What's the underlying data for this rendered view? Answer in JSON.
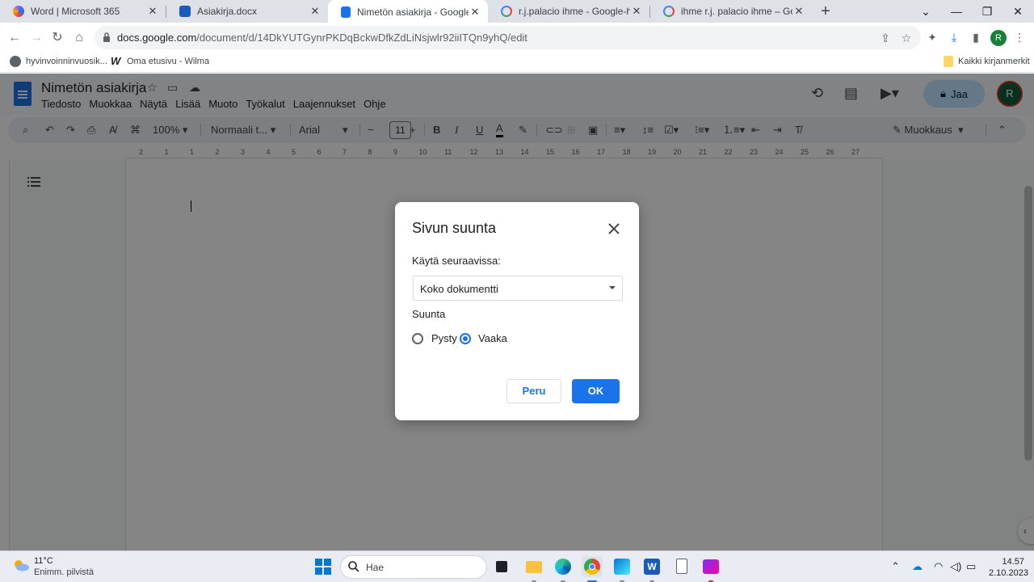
{
  "browser": {
    "tabs": [
      {
        "title": "Word | Microsoft 365",
        "favicon": "m365-icon",
        "active": false
      },
      {
        "title": "Asiakirja.docx",
        "favicon": "word-icon",
        "active": false
      },
      {
        "title": "Nimetön asiakirja - Google Docs",
        "favicon": "docs-icon",
        "active": true
      },
      {
        "title": "r.j.palacio ihme - Google-haku",
        "favicon": "google-icon",
        "active": false
      },
      {
        "title": "ihme r.j. palacio ihme – Google-",
        "favicon": "google-icon",
        "active": false
      }
    ],
    "close_glyph": "✕",
    "new_tab_glyph": "+",
    "url_host": "docs.google.com",
    "url_path": "/document/d/14DkYUTGynrPKDqBckwDfkZdLiNsjwlr92iiITQn9yhQ/edit",
    "profile_letter": "R",
    "bookmarks": [
      {
        "label": "hyvinvoinninvuosik...",
        "icon": "globe-icon"
      },
      {
        "label": "Oma etusivu - Wilma",
        "icon": "wilma-icon"
      }
    ],
    "bookmarks_folder": "Kaikki kirjanmerkit"
  },
  "docs": {
    "title": "Nimetön asiakirja",
    "menu": [
      "Tiedosto",
      "Muokkaa",
      "Näytä",
      "Lisää",
      "Muoto",
      "Työkalut",
      "Laajennukset",
      "Ohje"
    ],
    "share_label": "Jaa",
    "account_letter": "R",
    "toolbar": {
      "zoom": "100%",
      "style": "Normaali t...",
      "font": "Arial",
      "font_size": "11",
      "mode": "Muokkaus"
    },
    "ruler_numbers": [
      "2",
      "1",
      "1",
      "2",
      "3",
      "4",
      "5",
      "6",
      "7",
      "8",
      "9",
      "10",
      "11",
      "12",
      "13",
      "14",
      "15",
      "16",
      "17",
      "18",
      "19",
      "20",
      "21",
      "22",
      "23",
      "24",
      "25",
      "26",
      "27"
    ]
  },
  "dialog": {
    "title": "Sivun suunta",
    "apply_label": "Käytä seuraavissa:",
    "apply_value": "Koko dokumentti",
    "orientation_label": "Suunta",
    "options": [
      {
        "label": "Pysty",
        "selected": false
      },
      {
        "label": "Vaaka",
        "selected": true
      }
    ],
    "cancel_label": "Peru",
    "ok_label": "OK"
  },
  "taskbar": {
    "weather_temp": "11°C",
    "weather_desc": "Enimm. pilvistä",
    "search_placeholder": "Hae",
    "time": "14.57",
    "date": "2.10.2023"
  },
  "colors": {
    "accent": "#1a73e8",
    "overlay": "rgba(0,0,0,0.48)",
    "share": "#c2e7ff"
  }
}
